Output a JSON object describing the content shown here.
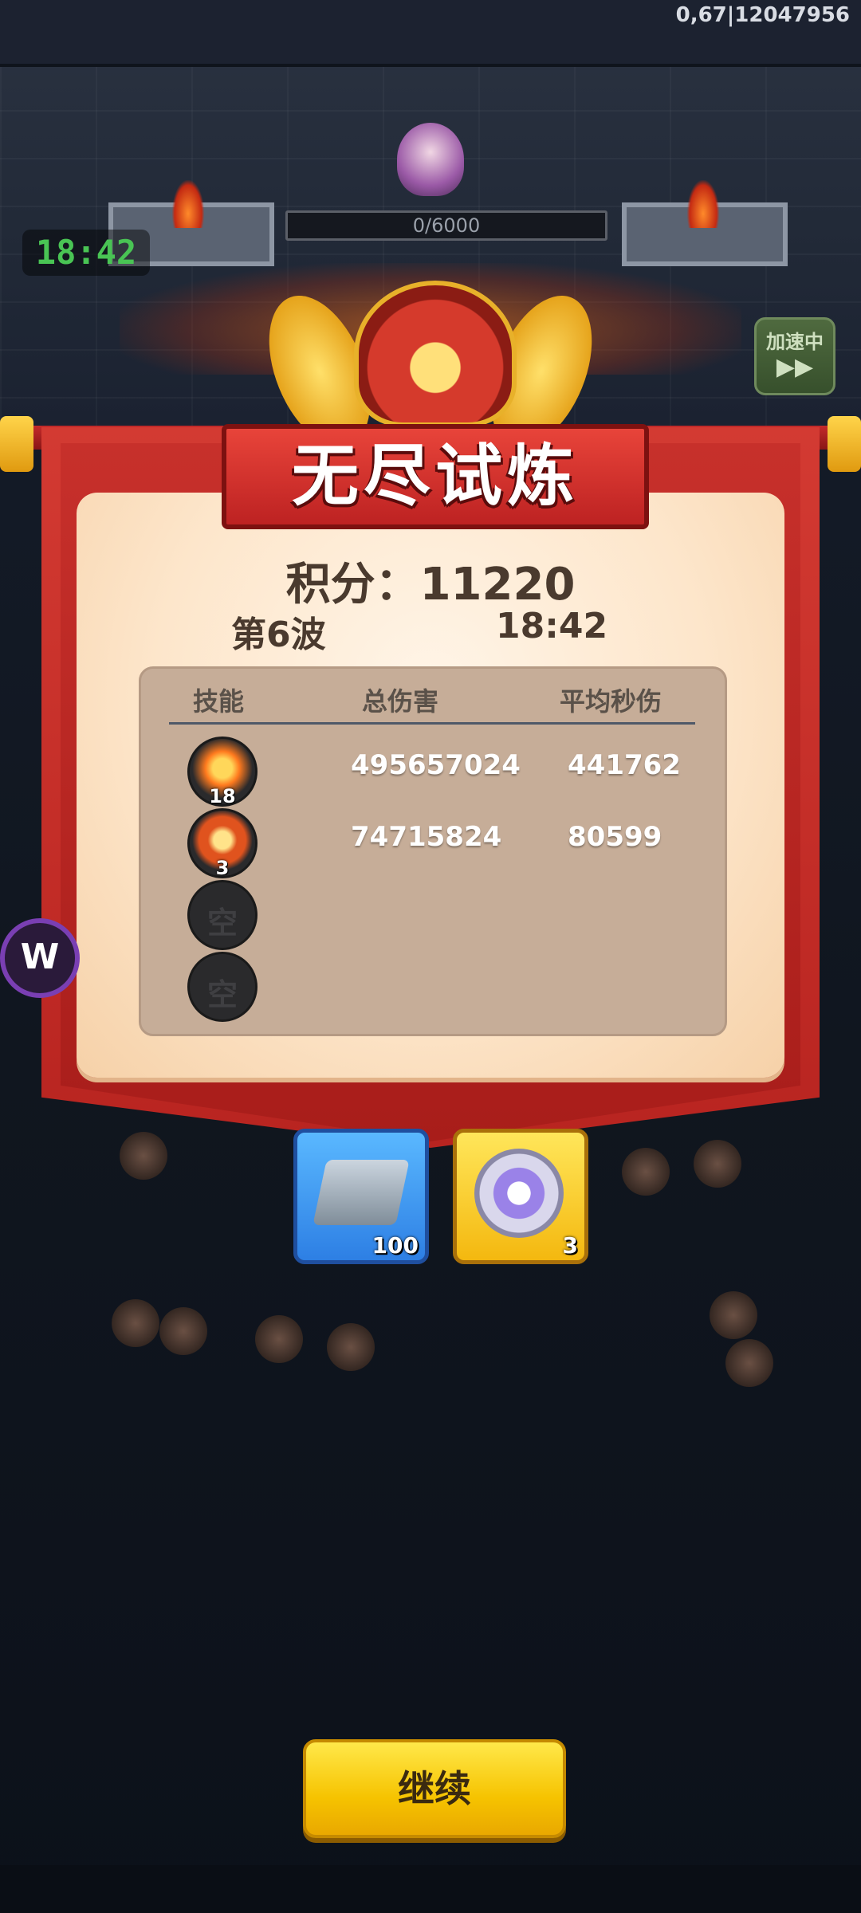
{
  "status": {
    "session_id": "0,67|12047956"
  },
  "hud": {
    "timer": "18:42",
    "boss_hp": "0/6000",
    "speed_button": {
      "label": "加速中",
      "icon": "fast-forward-icon"
    }
  },
  "dialog": {
    "title": "无尽试炼",
    "score_label": "积分：",
    "score": "11220",
    "wave": "第6波",
    "time": "18:42",
    "table": {
      "headers": [
        "技能",
        "总伤害",
        "平均秒伤"
      ],
      "rows": [
        {
          "icon": "fire-skill-icon",
          "level": "18",
          "total_damage": "495657024",
          "avg_dps": "441762"
        },
        {
          "icon": "ring-skill-icon",
          "level": "3",
          "total_damage": "74715824",
          "avg_dps": "80599"
        },
        {
          "icon": "empty-slot",
          "empty_label": "空"
        },
        {
          "icon": "empty-slot",
          "empty_label": "空"
        }
      ]
    }
  },
  "rewards": [
    {
      "icon": "puzzle-piece-icon",
      "quantity": "100",
      "color": "#3d94f2"
    },
    {
      "icon": "purple-token-icon",
      "quantity": "3",
      "color": "#f7c21a"
    }
  ],
  "side_logo": {
    "icon": "w-logo-icon",
    "text": "W"
  },
  "continue_button": {
    "label": "继续"
  },
  "colors": {
    "banner": "#c82a26",
    "accent": "#f6c300",
    "timer": "#49c454"
  }
}
